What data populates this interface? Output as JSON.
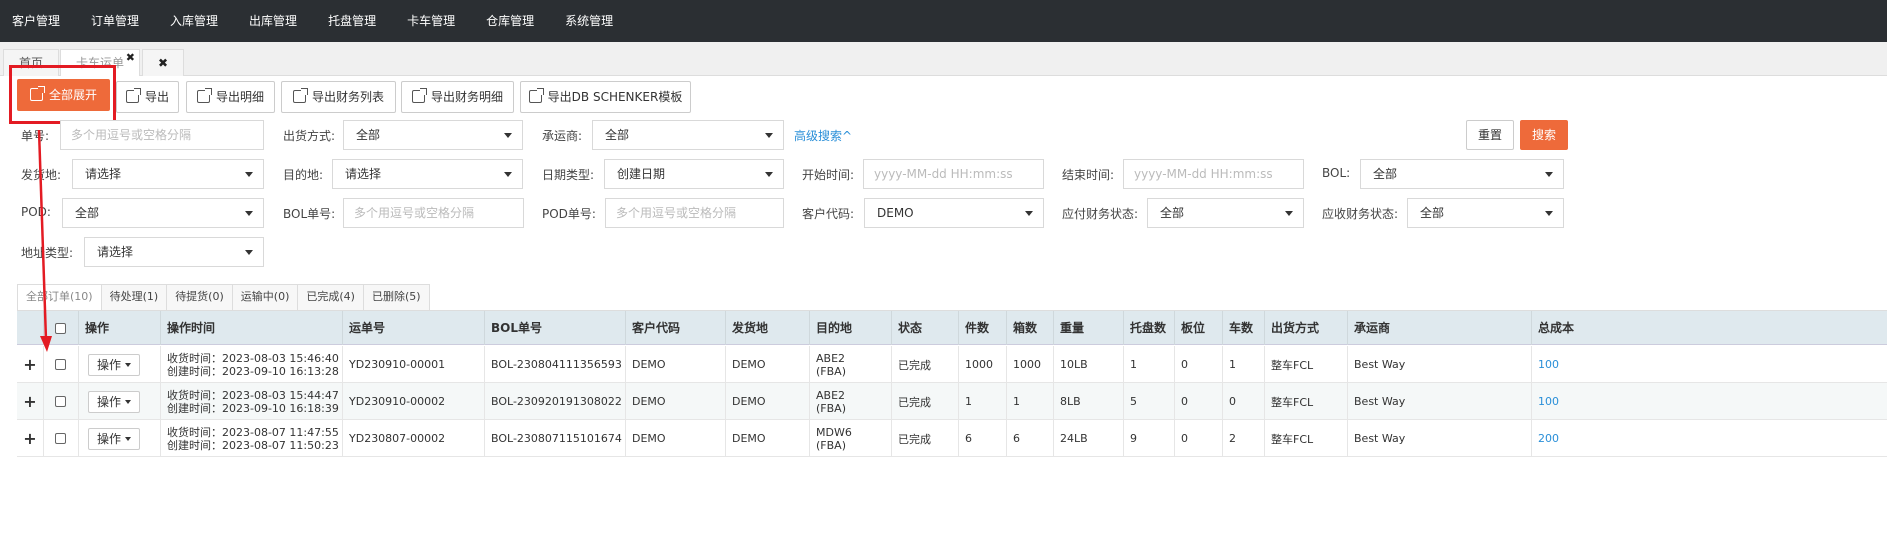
{
  "top_nav": [
    "客户管理",
    "订单管理",
    "入库管理",
    "出库管理",
    "托盘管理",
    "卡车管理",
    "仓库管理",
    "系统管理"
  ],
  "tabs": {
    "home": "首页",
    "truck_waybill": "卡车运单",
    "truck_close": "✖",
    "close_all": "✖"
  },
  "toolbar": {
    "expand_all": "全部展开",
    "export": "导出",
    "export_detail": "导出明细",
    "export_finance_list": "导出财务列表",
    "export_finance_detail": "导出财务明细",
    "export_db": "导出DB SCHENKER模板"
  },
  "filters": {
    "order_no_label": "单号:",
    "order_no_placeholder": "多个用逗号或空格分隔",
    "ship_method_label": "出货方式:",
    "ship_method_value": "全部",
    "carrier_label": "承运商:",
    "carrier_value": "全部",
    "advanced_search": "高级搜索^",
    "reset": "重置",
    "search": "搜索",
    "origin_label": "发货地:",
    "origin_value": "请选择",
    "destination_label": "目的地:",
    "destination_value": "请选择",
    "date_type_label": "日期类型:",
    "date_type_value": "创建日期",
    "start_time_label": "开始时间:",
    "start_time_placeholder": "yyyy-MM-dd HH:mm:ss",
    "end_time_label": "结束时间:",
    "end_time_placeholder": "yyyy-MM-dd HH:mm:ss",
    "bol_label": "BOL:",
    "bol_value": "全部",
    "pod_label": "POD:",
    "pod_value": "全部",
    "bol_no_label": "BOL单号:",
    "bol_no_placeholder": "多个用逗号或空格分隔",
    "pod_no_label": "POD单号:",
    "pod_no_placeholder": "多个用逗号或空格分隔",
    "customer_code_label": "客户代码:",
    "customer_code_value": "DEMO",
    "payable_label": "应付财务状态:",
    "payable_value": "全部",
    "receivable_label": "应收财务状态:",
    "receivable_value": "全部",
    "address_type_label": "地址类型:",
    "address_type_value": "请选择"
  },
  "status_tabs": [
    "全部订单(10)",
    "待处理(1)",
    "待提货(0)",
    "运输中(0)",
    "已完成(4)",
    "已删除(5)"
  ],
  "table": {
    "headers": [
      "操作",
      "操作时间",
      "运单号",
      "BOL单号",
      "客户代码",
      "发货地",
      "目的地",
      "状态",
      "件数",
      "箱数",
      "重量",
      "托盘数",
      "板位",
      "车数",
      "出货方式",
      "承运商",
      "总成本"
    ],
    "op_button": "操作",
    "rows": [
      {
        "received": "收货时间：2023-08-03 15:46:40",
        "created": "创建时间：2023-09-10 16:13:28",
        "waybill": "YD230910-00001",
        "bol": "BOL-230804111356593",
        "customer": "DEMO",
        "origin": "DEMO",
        "dest1": "ABE2",
        "dest2": "(FBA)",
        "status": "已完成",
        "pieces": "1000",
        "boxes": "1000",
        "weight": "10LB",
        "pallets": "1",
        "positions": "0",
        "trucks": "1",
        "ship_method": "整车FCL",
        "carrier": "Best Way",
        "cost": "100"
      },
      {
        "received": "收货时间：2023-08-03 15:44:47",
        "created": "创建时间：2023-09-10 16:18:39",
        "waybill": "YD230910-00002",
        "bol": "BOL-230920191308022",
        "customer": "DEMO",
        "origin": "DEMO",
        "dest1": "ABE2",
        "dest2": "(FBA)",
        "status": "已完成",
        "pieces": "1",
        "boxes": "1",
        "weight": "8LB",
        "pallets": "5",
        "positions": "0",
        "trucks": "0",
        "ship_method": "整车FCL",
        "carrier": "Best Way",
        "cost": "100"
      },
      {
        "received": "收货时间：2023-08-07 11:47:55",
        "created": "创建时间：2023-08-07 11:50:23",
        "waybill": "YD230807-00002",
        "bol": "BOL-230807115101674",
        "customer": "DEMO",
        "origin": "DEMO",
        "dest1": "MDW6",
        "dest2": "(FBA)",
        "status": "已完成",
        "pieces": "6",
        "boxes": "6",
        "weight": "24LB",
        "pallets": "9",
        "positions": "0",
        "trucks": "2",
        "ship_method": "整车FCL",
        "carrier": "Best Way",
        "cost": "200"
      }
    ]
  },
  "colors": {
    "nav_bg": "#2b2f33",
    "primary": "#ee6a3a",
    "link": "#2a8fd8",
    "highlight": "#e31b23",
    "header_bg": "#dfe9ee"
  },
  "icons": {
    "toolbar_button": "export-icon",
    "expand_row": "plus-icon"
  }
}
